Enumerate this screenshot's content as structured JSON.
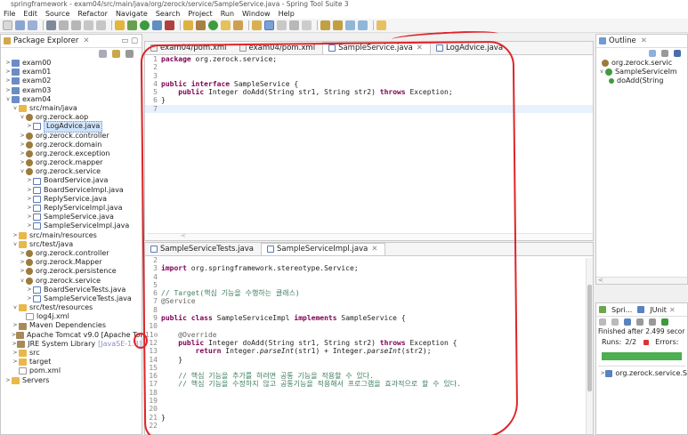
{
  "window": {
    "title": "springframework - exam04/src/main/java/org/zerock/service/SampleService.java - Spring Tool Suite 3"
  },
  "menu": [
    "File",
    "Edit",
    "Source",
    "Refactor",
    "Navigate",
    "Search",
    "Project",
    "Run",
    "Window",
    "Help"
  ],
  "package_explorer": {
    "title": "Package Explorer",
    "items": [
      {
        "depth": 0,
        "label": "exam00",
        "icon": "project-icon",
        "twisty": ">"
      },
      {
        "depth": 0,
        "label": "exam01",
        "icon": "project-icon",
        "twisty": ">"
      },
      {
        "depth": 0,
        "label": "exam02",
        "icon": "project-icon",
        "twisty": ">"
      },
      {
        "depth": 0,
        "label": "exam03",
        "icon": "project-icon",
        "twisty": ">"
      },
      {
        "depth": 0,
        "label": "exam04",
        "icon": "project-icon",
        "twisty": "v"
      },
      {
        "depth": 1,
        "label": "src/main/java",
        "icon": "folder-icon",
        "twisty": "v"
      },
      {
        "depth": 2,
        "label": "org.zerock.aop",
        "icon": "package-icon",
        "twisty": "v"
      },
      {
        "depth": 3,
        "label": "LogAdvice.java",
        "icon": "java-file-icon",
        "twisty": ">",
        "selected": true
      },
      {
        "depth": 2,
        "label": "org.zerock.controller",
        "icon": "package-icon",
        "twisty": ">"
      },
      {
        "depth": 2,
        "label": "org.zerock.domain",
        "icon": "package-icon",
        "twisty": ">"
      },
      {
        "depth": 2,
        "label": "org.zerock.exception",
        "icon": "package-icon",
        "twisty": ">"
      },
      {
        "depth": 2,
        "label": "org.zerock.mapper",
        "icon": "package-icon",
        "twisty": ">"
      },
      {
        "depth": 2,
        "label": "org.zerock.service",
        "icon": "package-icon",
        "twisty": "v"
      },
      {
        "depth": 3,
        "label": "BoardService.java",
        "icon": "java-file-icon",
        "twisty": ">"
      },
      {
        "depth": 3,
        "label": "BoardServiceImpl.java",
        "icon": "java-file-icon",
        "twisty": ">"
      },
      {
        "depth": 3,
        "label": "ReplyService.java",
        "icon": "java-file-icon",
        "twisty": ">"
      },
      {
        "depth": 3,
        "label": "ReplyServiceImpl.java",
        "icon": "java-file-icon",
        "twisty": ">"
      },
      {
        "depth": 3,
        "label": "SampleService.java",
        "icon": "java-file-icon",
        "twisty": ">"
      },
      {
        "depth": 3,
        "label": "SampleServiceImpl.java",
        "icon": "java-file-icon",
        "twisty": ">"
      },
      {
        "depth": 1,
        "label": "src/main/resources",
        "icon": "folder-icon",
        "twisty": ">"
      },
      {
        "depth": 1,
        "label": "src/test/java",
        "icon": "folder-icon",
        "twisty": "v"
      },
      {
        "depth": 2,
        "label": "org.zerock.controller",
        "icon": "package-icon",
        "twisty": ">"
      },
      {
        "depth": 2,
        "label": "org.zerock.Mapper",
        "icon": "package-icon",
        "twisty": ">"
      },
      {
        "depth": 2,
        "label": "org.zerock.persistence",
        "icon": "package-icon",
        "twisty": ">"
      },
      {
        "depth": 2,
        "label": "org.zerock.service",
        "icon": "package-icon",
        "twisty": "v"
      },
      {
        "depth": 3,
        "label": "BoardServiceTests.java",
        "icon": "java-file-icon",
        "twisty": ">"
      },
      {
        "depth": 3,
        "label": "SampleServiceTests.java",
        "icon": "java-file-icon",
        "twisty": ">"
      },
      {
        "depth": 1,
        "label": "src/test/resources",
        "icon": "folder-icon",
        "twisty": "v"
      },
      {
        "depth": 2,
        "label": "log4j.xml",
        "icon": "xml-file-icon",
        "twisty": ""
      },
      {
        "depth": 1,
        "label": "Maven Dependencies",
        "icon": "library-icon",
        "twisty": ">"
      },
      {
        "depth": 1,
        "label": "Apache Tomcat v9.0 [Apache Tom",
        "icon": "library-icon",
        "twisty": ">"
      },
      {
        "depth": 1,
        "label": "JRE System Library",
        "suffix": "[JavaSE-1.8]",
        "icon": "library-icon",
        "twisty": ">"
      },
      {
        "depth": 1,
        "label": "src",
        "icon": "folder-icon",
        "twisty": ">"
      },
      {
        "depth": 1,
        "label": "target",
        "icon": "folder-icon",
        "twisty": ">"
      },
      {
        "depth": 1,
        "label": "pom.xml",
        "icon": "xml-file-icon",
        "twisty": ""
      },
      {
        "depth": 0,
        "label": "Servers",
        "icon": "folder-icon",
        "twisty": ">"
      }
    ]
  },
  "top_editor": {
    "tabs": [
      {
        "label": "exam04/pom.xml",
        "active": false
      },
      {
        "label": "exam04/pom.xml",
        "active": false
      },
      {
        "label": "SampleService.java",
        "active": true
      },
      {
        "label": "LogAdvice.java",
        "active": false
      }
    ],
    "lines": [
      {
        "n": "1",
        "text": "package org.zerock.service;"
      },
      {
        "n": "2",
        "text": ""
      },
      {
        "n": "3",
        "text": ""
      },
      {
        "n": "4",
        "text": "public interface SampleService {"
      },
      {
        "n": "5",
        "text": "    public Integer doAdd(String str1, String str2) throws Exception;"
      },
      {
        "n": "6",
        "text": "}"
      },
      {
        "n": "7",
        "text": ""
      }
    ]
  },
  "bottom_editor": {
    "tabs": [
      {
        "label": "SampleServiceTests.java",
        "active": false
      },
      {
        "label": "SampleServiceImpl.java",
        "active": true
      }
    ],
    "lines": [
      {
        "n": "2",
        "text": ""
      },
      {
        "n": "3",
        "text": "import org.springframework.stereotype.Service;"
      },
      {
        "n": "4",
        "text": ""
      },
      {
        "n": "5",
        "text": ""
      },
      {
        "n": "6",
        "text": "// Target(핵심 기능을 수행하는 클래스)"
      },
      {
        "n": "7",
        "text": "@Service"
      },
      {
        "n": "8",
        "text": ""
      },
      {
        "n": "9",
        "text": "public class SampleServiceImpl implements SampleService {"
      },
      {
        "n": "10",
        "text": ""
      },
      {
        "n": "11⊖",
        "text": "    @Override"
      },
      {
        "n": "12",
        "text": "    public Integer doAdd(String str1, String str2) throws Exception {"
      },
      {
        "n": "13",
        "text": "        return Integer.parseInt(str1) + Integer.parseInt(str2);"
      },
      {
        "n": "14",
        "text": "    }"
      },
      {
        "n": "15",
        "text": ""
      },
      {
        "n": "16",
        "text": "    // 핵심 기능을 추가를 하려면 공통 기능을 적용할 수 있다."
      },
      {
        "n": "17",
        "text": "    // 핵심 기능을 수정하지 않고 공통기능을 적용해서 프로그램을 효과적으로 할 수 있다."
      },
      {
        "n": "18",
        "text": ""
      },
      {
        "n": "19",
        "text": ""
      },
      {
        "n": "20",
        "text": ""
      },
      {
        "n": "21",
        "text": "}"
      },
      {
        "n": "22",
        "text": ""
      }
    ]
  },
  "outline": {
    "title": "Outline",
    "items": [
      {
        "label": "org.zerock.servic"
      },
      {
        "label": "SampleServiceIm"
      },
      {
        "label": "doAdd(String"
      }
    ]
  },
  "junit": {
    "tabs": [
      "Spri...",
      "JUnit"
    ],
    "finished": "Finished after 2.499 secor",
    "runs_label": "Runs:",
    "runs_value": "2/2",
    "errors_label": "Errors:",
    "result_item": "org.zerock.service.S"
  },
  "colors": {
    "annotation_red": "#e0242a",
    "junit_green": "#4caf50",
    "keyword": "#7f0055",
    "comment": "#3f7f5f"
  }
}
